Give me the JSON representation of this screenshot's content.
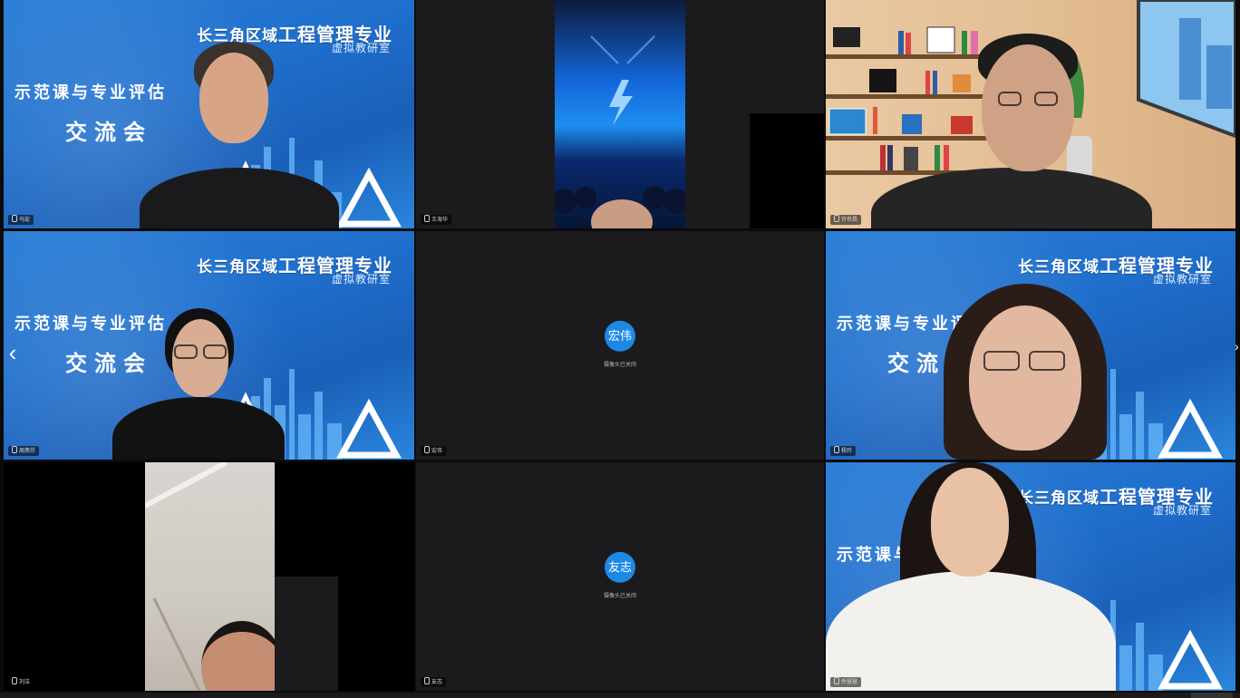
{
  "banner": {
    "title_prefix": "长三角区域",
    "title_main": "工程管理专业",
    "title_sub": "虚拟教研室",
    "sub_line_a": "示范课与专业评估",
    "sub_line_b": "交流会"
  },
  "tiles": [
    {
      "name": "马宏",
      "kind": "video"
    },
    {
      "name": "王海华",
      "kind": "video"
    },
    {
      "name": "许世昌",
      "kind": "video"
    },
    {
      "name": "周燕芬",
      "kind": "video"
    },
    {
      "name": "宏伟",
      "kind": "avatar",
      "avatar_text": "宏伟",
      "sub_text": "摄像头已关闭"
    },
    {
      "name": "杨玲",
      "kind": "video"
    },
    {
      "name": "刘洁",
      "kind": "video"
    },
    {
      "name": "友志",
      "kind": "avatar",
      "avatar_text": "友志",
      "sub_text": "摄像头已关闭"
    },
    {
      "name": "乔慧慧",
      "kind": "video"
    }
  ],
  "nav": {
    "prev_glyph": "‹",
    "next_glyph": "›"
  },
  "colors": {
    "banner_blue": "#1f6fcd",
    "avatar_blue": "#1e88e5",
    "tile_dark": "#1b1b1d"
  }
}
